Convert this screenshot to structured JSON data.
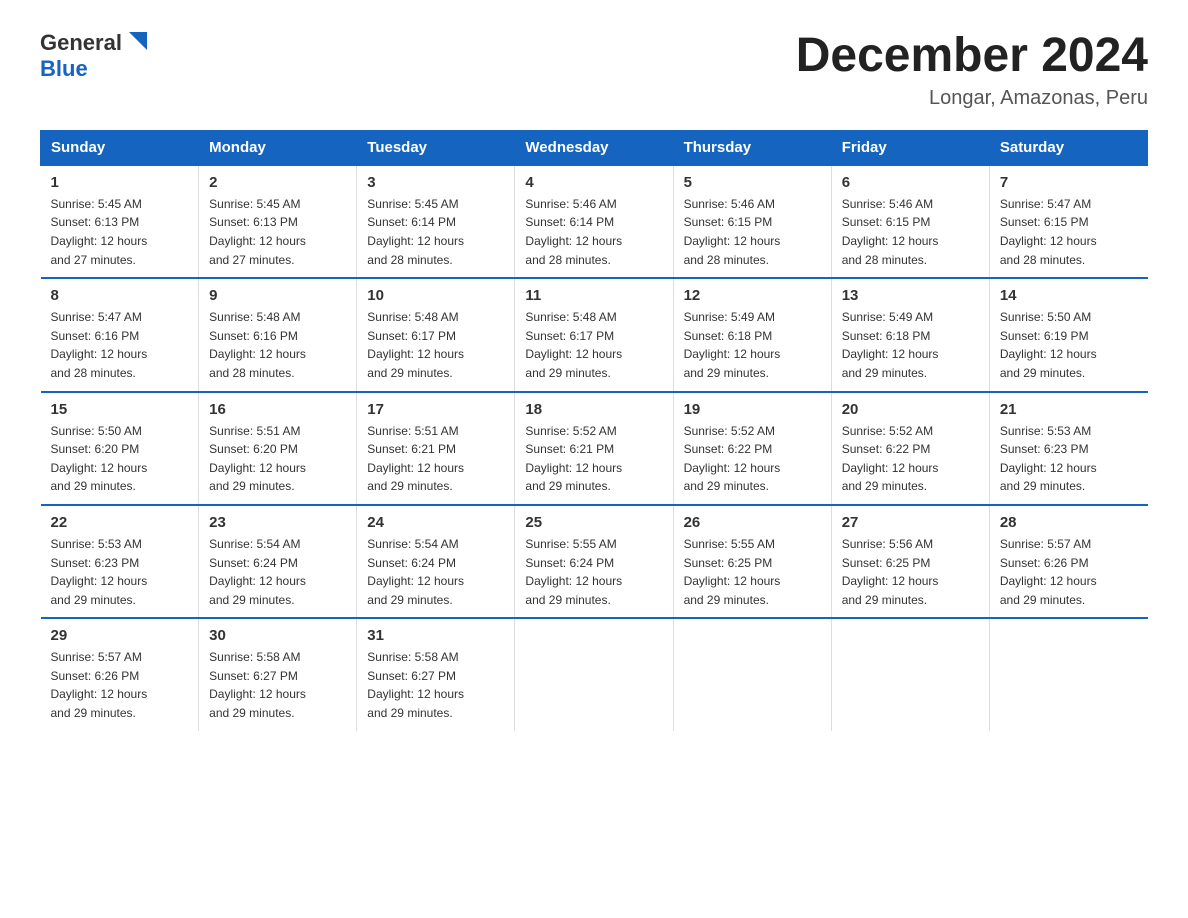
{
  "logo": {
    "text_general": "General",
    "text_blue": "Blue",
    "triangle": "▶"
  },
  "title": "December 2024",
  "subtitle": "Longar, Amazonas, Peru",
  "days_of_week": [
    "Sunday",
    "Monday",
    "Tuesday",
    "Wednesday",
    "Thursday",
    "Friday",
    "Saturday"
  ],
  "weeks": [
    [
      {
        "day": "1",
        "sunrise": "5:45 AM",
        "sunset": "6:13 PM",
        "daylight": "12 hours and 27 minutes."
      },
      {
        "day": "2",
        "sunrise": "5:45 AM",
        "sunset": "6:13 PM",
        "daylight": "12 hours and 27 minutes."
      },
      {
        "day": "3",
        "sunrise": "5:45 AM",
        "sunset": "6:14 PM",
        "daylight": "12 hours and 28 minutes."
      },
      {
        "day": "4",
        "sunrise": "5:46 AM",
        "sunset": "6:14 PM",
        "daylight": "12 hours and 28 minutes."
      },
      {
        "day": "5",
        "sunrise": "5:46 AM",
        "sunset": "6:15 PM",
        "daylight": "12 hours and 28 minutes."
      },
      {
        "day": "6",
        "sunrise": "5:46 AM",
        "sunset": "6:15 PM",
        "daylight": "12 hours and 28 minutes."
      },
      {
        "day": "7",
        "sunrise": "5:47 AM",
        "sunset": "6:15 PM",
        "daylight": "12 hours and 28 minutes."
      }
    ],
    [
      {
        "day": "8",
        "sunrise": "5:47 AM",
        "sunset": "6:16 PM",
        "daylight": "12 hours and 28 minutes."
      },
      {
        "day": "9",
        "sunrise": "5:48 AM",
        "sunset": "6:16 PM",
        "daylight": "12 hours and 28 minutes."
      },
      {
        "day": "10",
        "sunrise": "5:48 AM",
        "sunset": "6:17 PM",
        "daylight": "12 hours and 29 minutes."
      },
      {
        "day": "11",
        "sunrise": "5:48 AM",
        "sunset": "6:17 PM",
        "daylight": "12 hours and 29 minutes."
      },
      {
        "day": "12",
        "sunrise": "5:49 AM",
        "sunset": "6:18 PM",
        "daylight": "12 hours and 29 minutes."
      },
      {
        "day": "13",
        "sunrise": "5:49 AM",
        "sunset": "6:18 PM",
        "daylight": "12 hours and 29 minutes."
      },
      {
        "day": "14",
        "sunrise": "5:50 AM",
        "sunset": "6:19 PM",
        "daylight": "12 hours and 29 minutes."
      }
    ],
    [
      {
        "day": "15",
        "sunrise": "5:50 AM",
        "sunset": "6:20 PM",
        "daylight": "12 hours and 29 minutes."
      },
      {
        "day": "16",
        "sunrise": "5:51 AM",
        "sunset": "6:20 PM",
        "daylight": "12 hours and 29 minutes."
      },
      {
        "day": "17",
        "sunrise": "5:51 AM",
        "sunset": "6:21 PM",
        "daylight": "12 hours and 29 minutes."
      },
      {
        "day": "18",
        "sunrise": "5:52 AM",
        "sunset": "6:21 PM",
        "daylight": "12 hours and 29 minutes."
      },
      {
        "day": "19",
        "sunrise": "5:52 AM",
        "sunset": "6:22 PM",
        "daylight": "12 hours and 29 minutes."
      },
      {
        "day": "20",
        "sunrise": "5:52 AM",
        "sunset": "6:22 PM",
        "daylight": "12 hours and 29 minutes."
      },
      {
        "day": "21",
        "sunrise": "5:53 AM",
        "sunset": "6:23 PM",
        "daylight": "12 hours and 29 minutes."
      }
    ],
    [
      {
        "day": "22",
        "sunrise": "5:53 AM",
        "sunset": "6:23 PM",
        "daylight": "12 hours and 29 minutes."
      },
      {
        "day": "23",
        "sunrise": "5:54 AM",
        "sunset": "6:24 PM",
        "daylight": "12 hours and 29 minutes."
      },
      {
        "day": "24",
        "sunrise": "5:54 AM",
        "sunset": "6:24 PM",
        "daylight": "12 hours and 29 minutes."
      },
      {
        "day": "25",
        "sunrise": "5:55 AM",
        "sunset": "6:24 PM",
        "daylight": "12 hours and 29 minutes."
      },
      {
        "day": "26",
        "sunrise": "5:55 AM",
        "sunset": "6:25 PM",
        "daylight": "12 hours and 29 minutes."
      },
      {
        "day": "27",
        "sunrise": "5:56 AM",
        "sunset": "6:25 PM",
        "daylight": "12 hours and 29 minutes."
      },
      {
        "day": "28",
        "sunrise": "5:57 AM",
        "sunset": "6:26 PM",
        "daylight": "12 hours and 29 minutes."
      }
    ],
    [
      {
        "day": "29",
        "sunrise": "5:57 AM",
        "sunset": "6:26 PM",
        "daylight": "12 hours and 29 minutes."
      },
      {
        "day": "30",
        "sunrise": "5:58 AM",
        "sunset": "6:27 PM",
        "daylight": "12 hours and 29 minutes."
      },
      {
        "day": "31",
        "sunrise": "5:58 AM",
        "sunset": "6:27 PM",
        "daylight": "12 hours and 29 minutes."
      },
      null,
      null,
      null,
      null
    ]
  ],
  "label_sunrise": "Sunrise:",
  "label_sunset": "Sunset:",
  "label_daylight": "Daylight:"
}
